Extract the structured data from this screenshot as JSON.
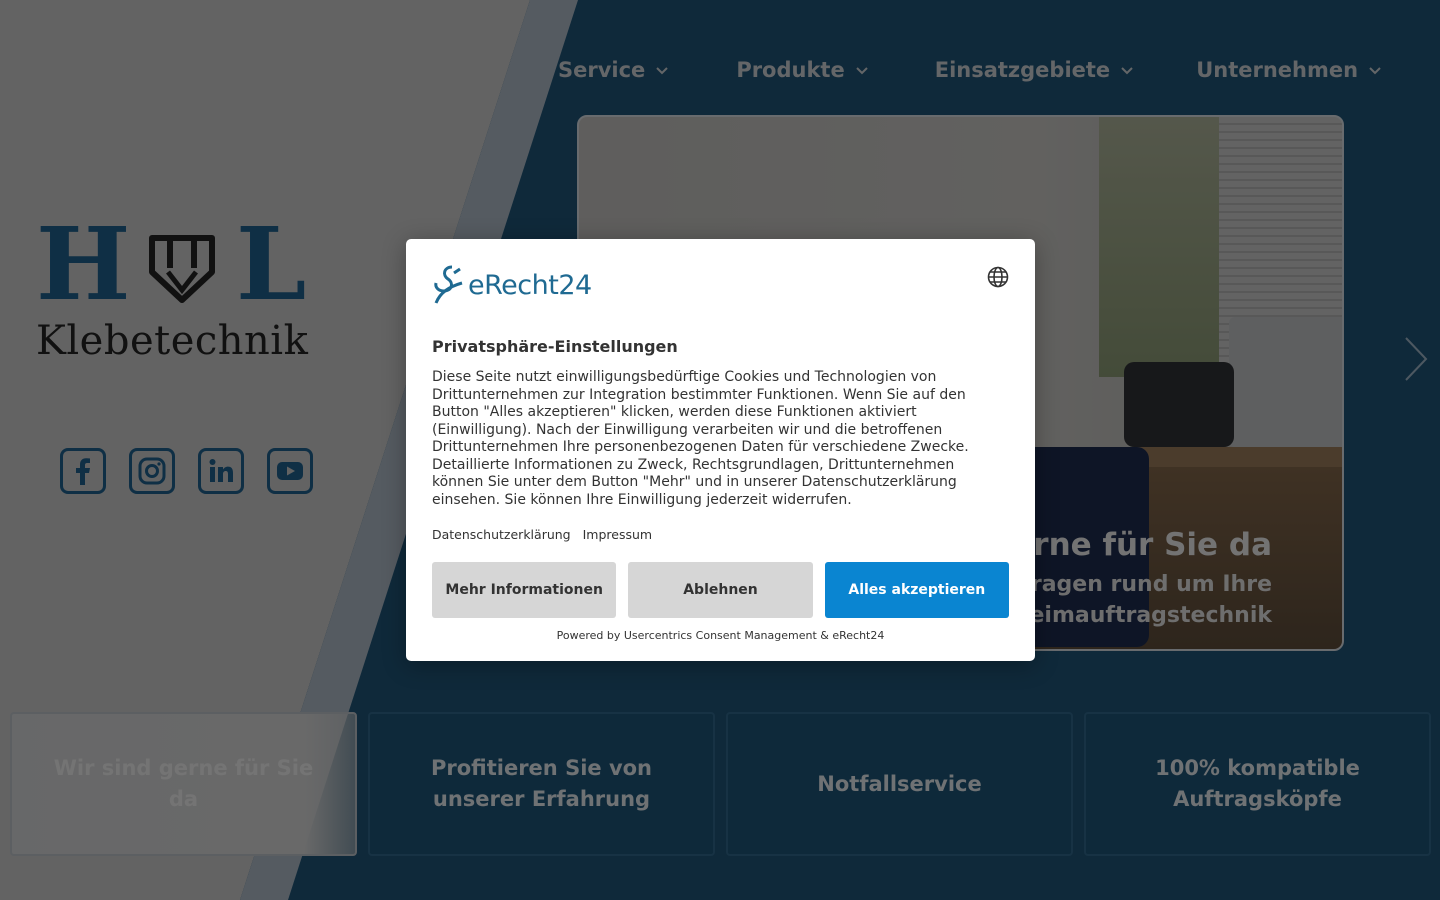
{
  "nav": {
    "items": [
      {
        "label": "Service"
      },
      {
        "label": "Produkte"
      },
      {
        "label": "Einsatzgebiete"
      },
      {
        "label": "Unternehmen"
      }
    ]
  },
  "logo": {
    "letter_left": "H",
    "letter_right": "L",
    "wordmark": "Klebetechnik"
  },
  "socials": [
    "facebook-icon",
    "instagram-icon",
    "linkedin-icon",
    "youtube-icon"
  ],
  "hero": {
    "caption_title": "rne für Sie da",
    "caption_sub_1": "ragen rund um Ihre",
    "caption_sub_2": "eimauftragstechnik"
  },
  "cards": [
    {
      "label": "Wir sind gerne für Sie da"
    },
    {
      "label": "Profitieren Sie von unserer Erfahrung"
    },
    {
      "label": "Notfallservice"
    },
    {
      "label": "100% kompatible Auftragsköpfe"
    }
  ],
  "consent": {
    "brand": "eRecht24",
    "title": "Privatsphäre-Einstellungen",
    "body": "Diese Seite nutzt einwilligungsbedürftige Cookies und Technologien von Drittunternehmen zur Integration bestimmter Funktionen. Wenn Sie auf den Button \"Alles akzeptieren\" klicken, werden diese Funktionen aktiviert (Einwilligung). Nach der Einwilligung verarbeiten wir und die betroffenen Drittunternehmen Ihre personenbezogenen Daten für verschiedene Zwecke. Detaillierte Informationen zu Zweck, Rechtsgrundlagen, Drittunternehmen können Sie unter dem Button \"Mehr\" und in unserer Datenschutzerklärung einsehen. Sie können Ihre Einwilligung jederzeit widerrufen.",
    "link_privacy": "Datenschutzerklärung",
    "link_imprint": "Impressum",
    "btn_more": "Mehr Informationen",
    "btn_deny": "Ablehnen",
    "btn_accept": "Alles akzeptieren",
    "powered": "Powered by Usercentrics Consent Management & eRecht24"
  },
  "colors": {
    "brand_blue": "#1f5f8b",
    "accept_blue": "#0a85d1",
    "page_blue": "#1e5375"
  }
}
